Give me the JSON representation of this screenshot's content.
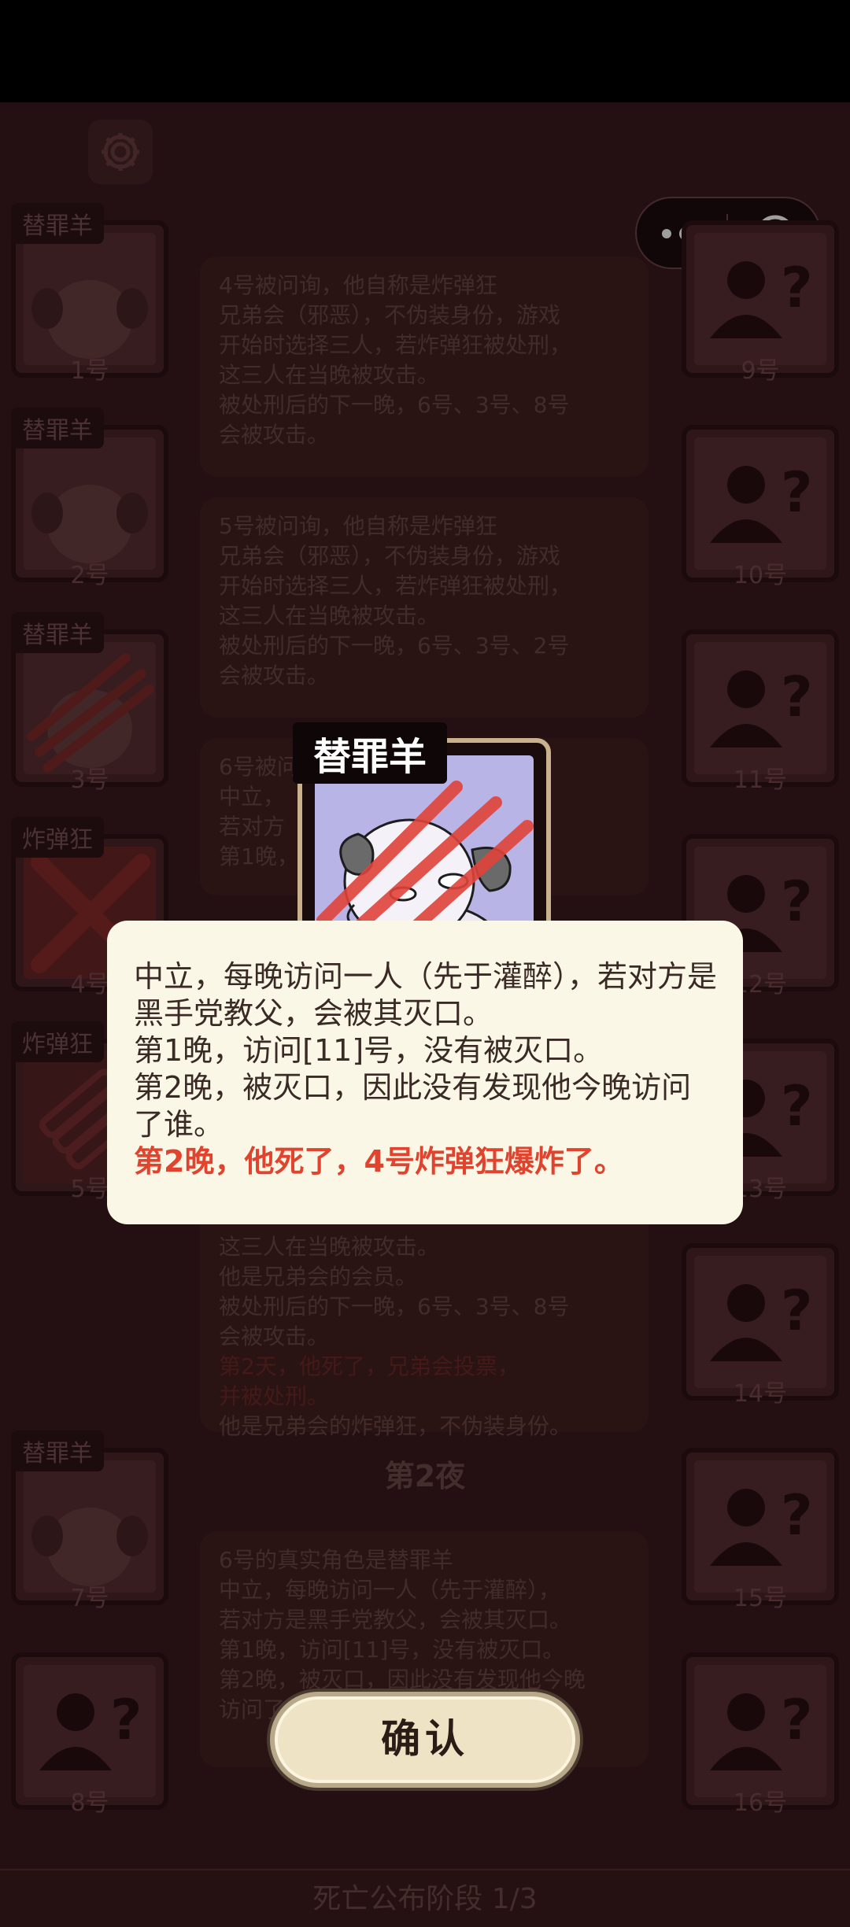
{
  "players_left": [
    {
      "num": "1号",
      "tag": "替罪羊",
      "kind": "scapegoat"
    },
    {
      "num": "2号",
      "tag": "替罪羊",
      "kind": "scapegoat"
    },
    {
      "num": "3号",
      "tag": "替罪羊",
      "kind": "scapegoat-dead"
    },
    {
      "num": "4号",
      "tag": "炸弹狂",
      "kind": "bomber-dead"
    },
    {
      "num": "5号",
      "tag": "炸弹狂",
      "kind": "bomber"
    },
    {
      "num": "7号",
      "tag": "替罪羊",
      "kind": "scapegoat"
    },
    {
      "num": "8号",
      "tag": "",
      "kind": "unknown"
    }
  ],
  "players_right": [
    {
      "num": "9号"
    },
    {
      "num": "10号"
    },
    {
      "num": "11号"
    },
    {
      "num": "12号"
    },
    {
      "num": "13号"
    },
    {
      "num": "14号"
    },
    {
      "num": "15号"
    },
    {
      "num": "16号"
    }
  ],
  "log": {
    "card1": [
      "4号被问询，他自称是炸弹狂",
      "兄弟会（邪恶），不伪装身份，游戏",
      "开始时选择三人，若炸弹狂被处刑，",
      "这三人在当晚被攻击。",
      "被处刑后的下一晚，6号、3号、8号",
      "会被攻击。"
    ],
    "card2": [
      "5号被问询，他自称是炸弹狂",
      "兄弟会（邪恶），不伪装身份，游戏",
      "开始时选择三人，若炸弹狂被处刑，",
      "这三人在当晚被攻击。",
      "被处刑后的下一晚，6号、3号、2号",
      "会被攻击。"
    ],
    "card3": [
      "6号被问询",
      "中立，",
      "若对方",
      "第1晚，"
    ],
    "card4": [
      "这三人在当晚被攻击。",
      "他是兄弟会的会员。",
      "被处刑后的下一晚，6号、3号、8号",
      "会被攻击。"
    ],
    "card4_red": [
      "第2天，他死了，兄弟会投票，",
      "并被处刑。"
    ],
    "card4_end": "他是兄弟会的炸弹狂，不伪装身份。",
    "night_title": "第2夜",
    "card5": [
      "6号的真实角色是替罪羊",
      "中立，每晚访问一人（先于灌醉），",
      "若对方是黑手党教父，会被其灭口。",
      "第1晚，访问[11]号，没有被灭口。",
      "第2晚，被灭口，因此没有发现他今晚",
      "访问了谁。"
    ],
    "phase": "死亡公布阶段 1/3"
  },
  "reveal": {
    "role_tag": "替罪羊",
    "player_num": "6号",
    "lines": [
      "中立，每晚访问一人（先于灌醉），若对方是黑手党教父，会被其灭口。",
      "第1晚，访问[11]号，没有被灭口。",
      "第2晚，被灭口，因此没有发现他今晚访问了谁。"
    ],
    "death_line": "第2晚，他死了，4号炸弹狂爆炸了。"
  },
  "confirm_label": "确认",
  "colors": {
    "accent_red": "#e0442f",
    "popup_bg": "#fbf7e6",
    "scratch": "#e0433a"
  }
}
